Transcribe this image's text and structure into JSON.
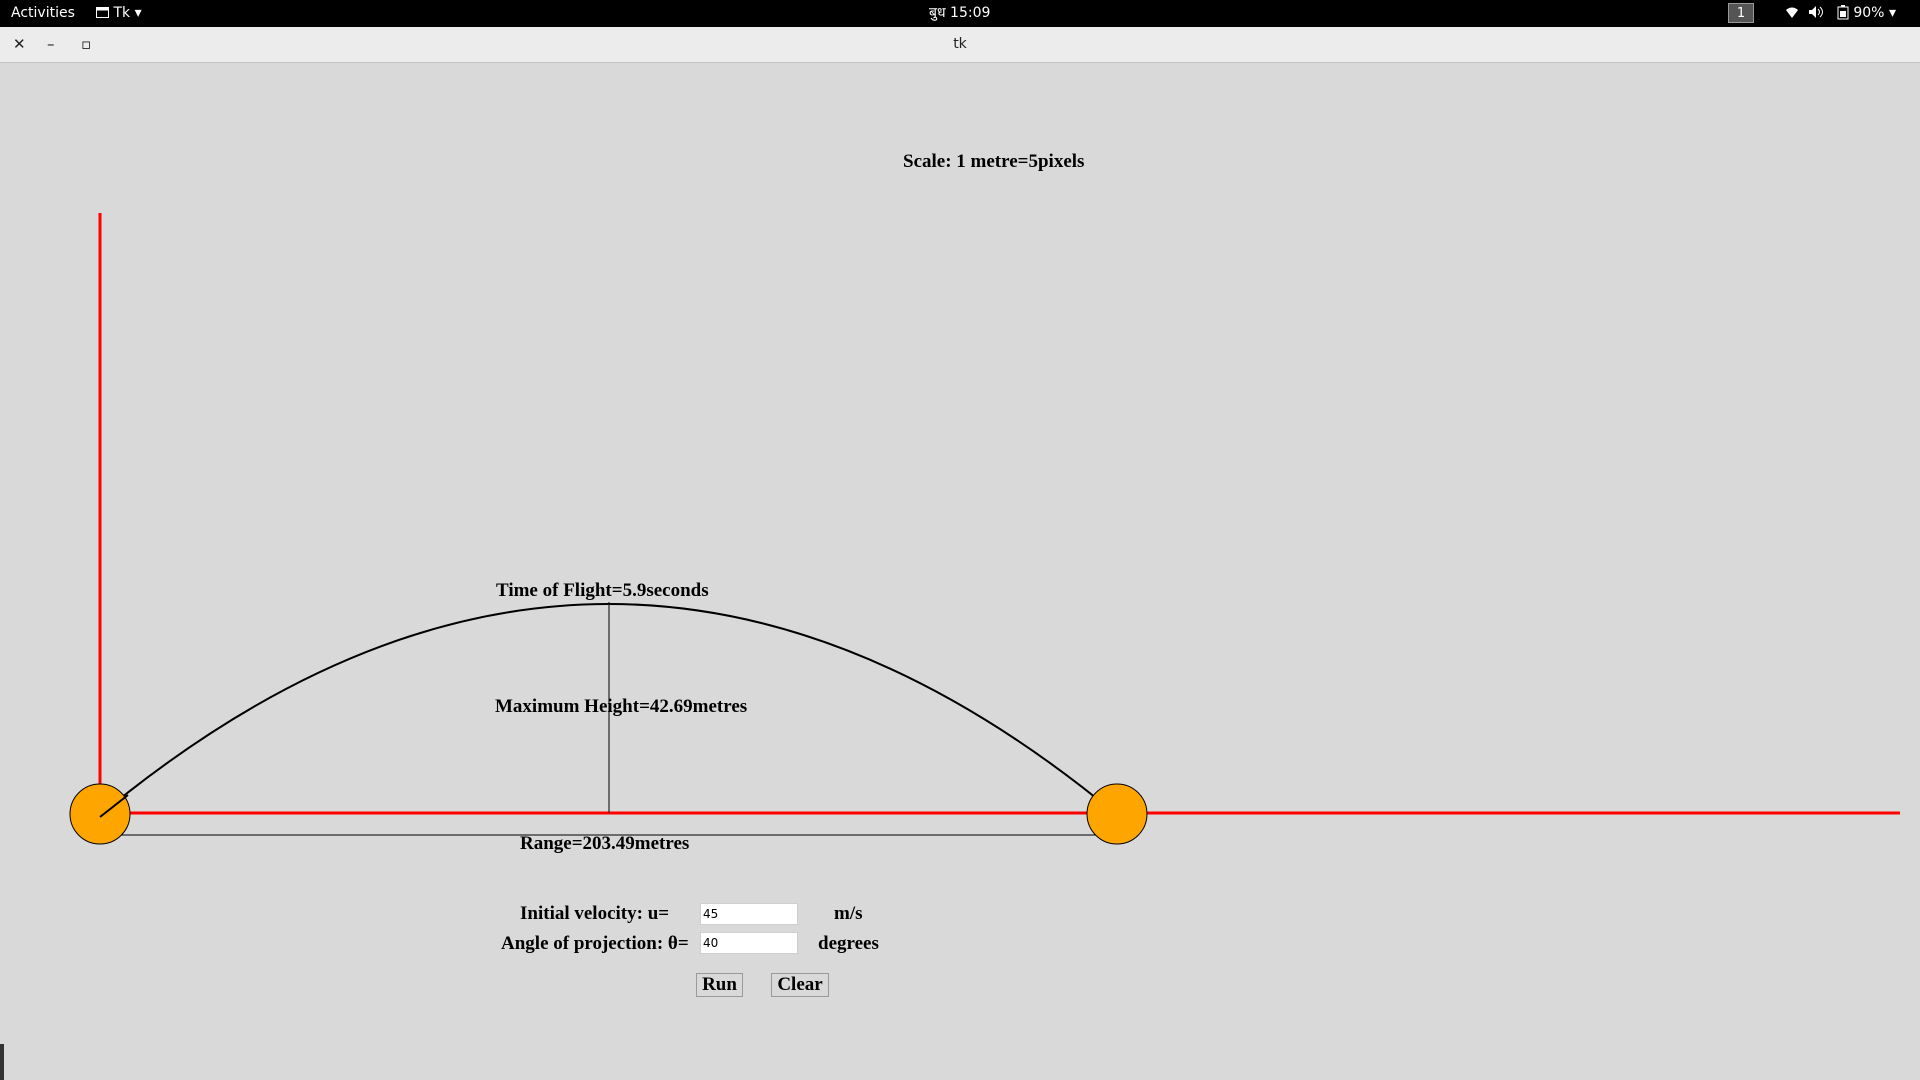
{
  "topbar": {
    "activities": "Activities",
    "app_menu": "Tk",
    "clock": "बुध 15:09",
    "workspace": "1",
    "battery": "90%"
  },
  "window": {
    "title": "tk",
    "close": "✕",
    "minimize": "–",
    "maximize": "▫"
  },
  "canvas": {
    "scale_label": "Scale: 1 metre=5pixels",
    "time_of_flight": "Time of Flight=5.9seconds",
    "max_height": "Maximum Height=42.69metres",
    "range": "Range=203.49metres",
    "colors": {
      "axis": "#ff0000",
      "ball": "#ffa500",
      "trajectory": "#000000"
    }
  },
  "form": {
    "velocity_label": "Initial velocity: u=",
    "velocity_value": "45",
    "velocity_unit": "m/s",
    "angle_label": "Angle of projection: θ=",
    "angle_value": "40",
    "angle_unit": "degrees",
    "run_label": "Run",
    "clear_label": "Clear"
  }
}
